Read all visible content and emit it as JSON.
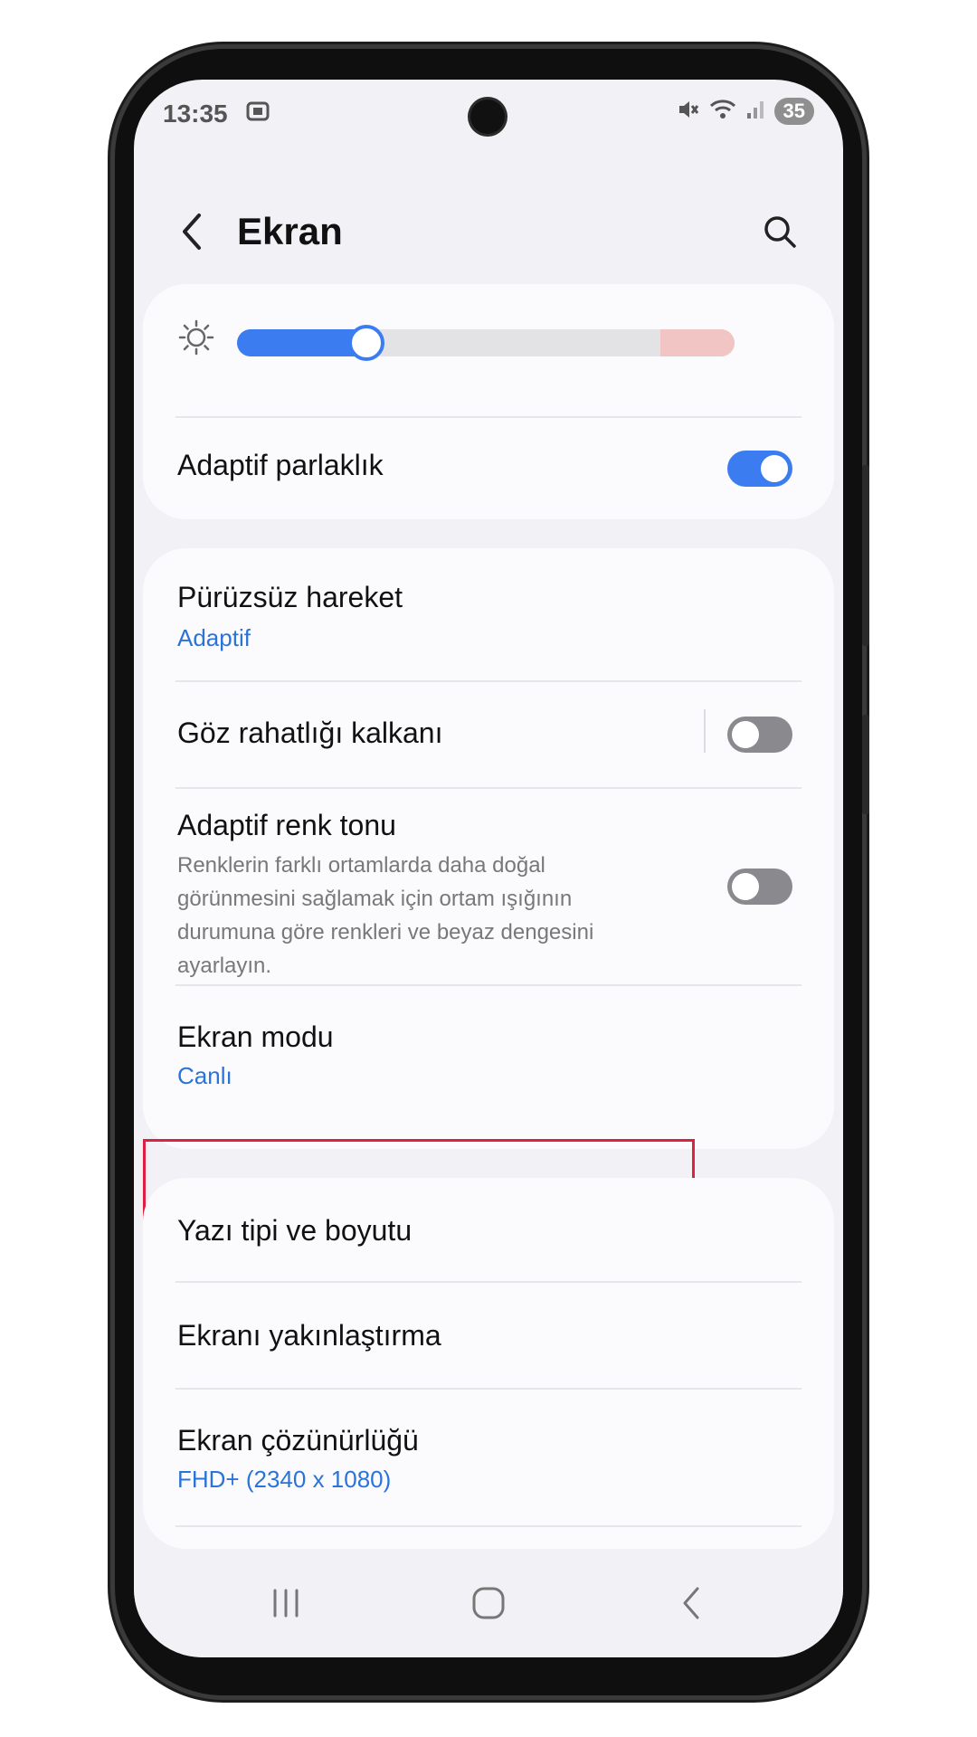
{
  "status_bar": {
    "time": "13:35",
    "battery": "35",
    "icons": [
      "screen-record-icon",
      "mute-icon",
      "wifi-icon",
      "signal-icon",
      "battery-icon"
    ]
  },
  "header": {
    "title": "Ekran"
  },
  "brightness": {
    "level": 0.26,
    "adaptive_label": "Adaptif parlaklık",
    "adaptive_on": true
  },
  "settings_group_1": {
    "smooth_motion": {
      "title": "Pürüzsüz hareket",
      "value": "Adaptif"
    },
    "eye_comfort": {
      "title": "Göz rahatlığı kalkanı",
      "on": false
    },
    "adaptive_tone": {
      "title": "Adaptif renk tonu",
      "description": "Renklerin farklı ortamlarda daha doğal görünmesini sağlamak için ortam ışığının durumuna göre renkleri ve beyaz dengesini ayarlayın.",
      "on": false
    },
    "screen_mode": {
      "title": "Ekran modu",
      "value": "Canlı"
    }
  },
  "settings_group_2": {
    "font": {
      "title": "Yazı tipi ve boyutu"
    },
    "zoom": {
      "title": "Ekranı yakınlaştırma"
    },
    "resolution": {
      "title": "Ekran çözünürlüğü",
      "value": "FHD+ (2340 x 1080)"
    }
  },
  "colors": {
    "accent": "#3b7df1",
    "link": "#2a74d9",
    "highlight_border": "#e02040"
  }
}
